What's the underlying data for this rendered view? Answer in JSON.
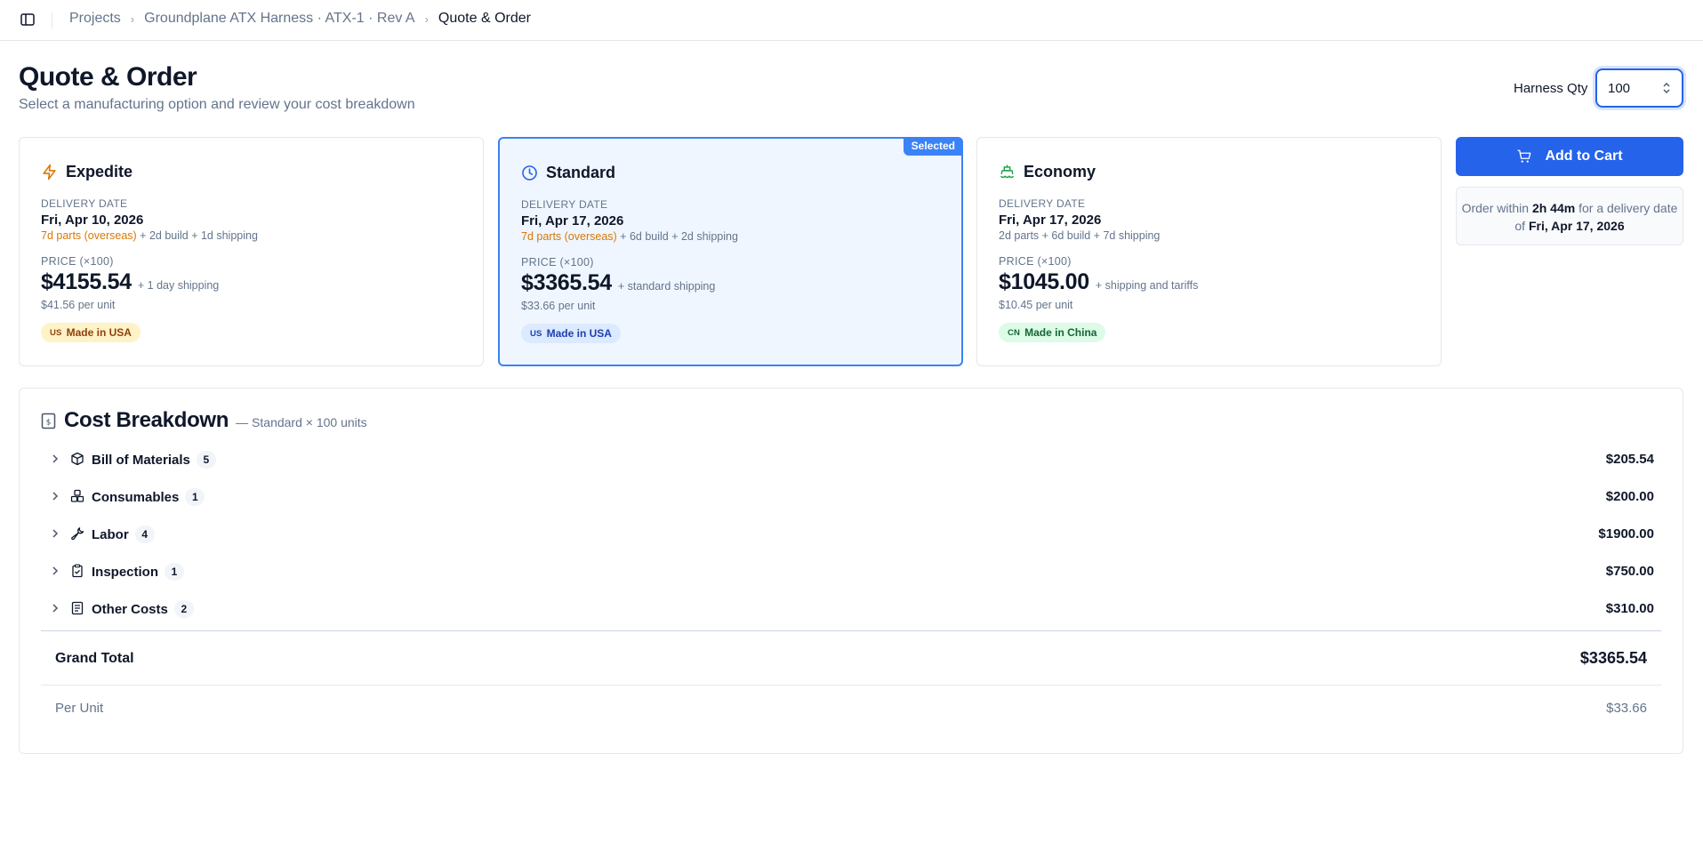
{
  "breadcrumb": {
    "items": [
      "Projects",
      "Groundplane ATX Harness · ATX-1 · Rev A"
    ],
    "current": "Quote & Order"
  },
  "header": {
    "title": "Quote & Order",
    "subtitle": "Select a manufacturing option and review your cost breakdown",
    "qty_label": "Harness Qty",
    "qty_value": "100"
  },
  "options": [
    {
      "name": "Expedite",
      "icon": "lightning-icon",
      "delivery_label": "DELIVERY DATE",
      "delivery_date": "Fri, Apr 10, 2026",
      "delivery_parts": "7d parts (overseas)",
      "delivery_rest": "+ 2d build + 1d shipping",
      "price_label": "PRICE (×100)",
      "price": "$4155.54",
      "price_note": "+ 1 day shipping",
      "per_unit": "$41.56 per unit",
      "origin_code": "US",
      "origin": "Made in USA"
    },
    {
      "name": "Standard",
      "icon": "clock-icon",
      "selected_tag": "Selected",
      "delivery_label": "DELIVERY DATE",
      "delivery_date": "Fri, Apr 17, 2026",
      "delivery_parts": "7d parts (overseas)",
      "delivery_rest": "+ 6d build + 2d shipping",
      "price_label": "PRICE (×100)",
      "price": "$3365.54",
      "price_note": "+ standard shipping",
      "per_unit": "$33.66 per unit",
      "origin_code": "US",
      "origin": "Made in USA"
    },
    {
      "name": "Economy",
      "icon": "ship-icon",
      "delivery_label": "DELIVERY DATE",
      "delivery_date": "Fri, Apr 17, 2026",
      "delivery_detail": "2d parts + 6d build + 7d shipping",
      "price_label": "PRICE (×100)",
      "price": "$1045.00",
      "price_note": "+ shipping and tariffs",
      "per_unit": "$10.45 per unit",
      "origin_code": "CN",
      "origin": "Made in China"
    }
  ],
  "cart": {
    "button_label": "Add to Cart",
    "note_prefix": "Order within",
    "note_time": "2h 44m",
    "note_middle": "for a delivery date of",
    "note_date": "Fri, Apr 17, 2026"
  },
  "breakdown": {
    "title": "Cost Breakdown",
    "subtitle": "— Standard × 100 units",
    "rows": [
      {
        "label": "Bill of Materials",
        "count": "5",
        "amount": "$205.54",
        "icon": "package-icon"
      },
      {
        "label": "Consumables",
        "count": "1",
        "amount": "$200.00",
        "icon": "boxes-icon"
      },
      {
        "label": "Labor",
        "count": "4",
        "amount": "$1900.00",
        "icon": "wrench-icon"
      },
      {
        "label": "Inspection",
        "count": "1",
        "amount": "$750.00",
        "icon": "clipboard-check-icon"
      },
      {
        "label": "Other Costs",
        "count": "2",
        "amount": "$310.00",
        "icon": "receipt-icon"
      }
    ],
    "grand_total_label": "Grand Total",
    "grand_total": "$3365.54",
    "per_unit_label": "Per Unit",
    "per_unit": "$33.66"
  },
  "colors": {
    "accent": "#2563eb",
    "selected_border": "#3b82f6",
    "selected_bg": "#eff6ff",
    "warning_text": "#d97706",
    "expedite_icon": "#d97706",
    "economy_icon": "#16a34a"
  }
}
